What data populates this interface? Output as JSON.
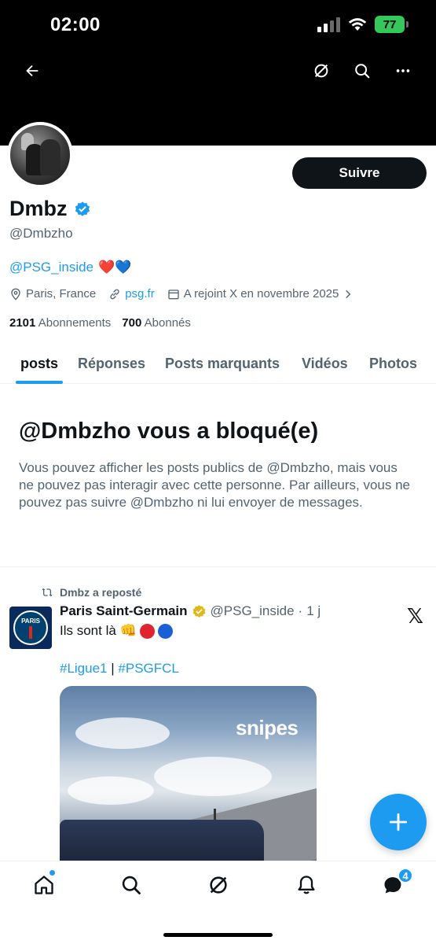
{
  "status_bar": {
    "time": "02:00",
    "battery": "77"
  },
  "header": {
    "back_icon": "arrow-left-icon",
    "grok_icon": "grok-icon",
    "search_icon": "search-icon",
    "more_icon": "more-horizontal-icon"
  },
  "profile": {
    "display_name": "Dmbz",
    "verified": true,
    "handle": "@Dmbzho",
    "bio_link": "@PSG_inside",
    "bio_emojis": "❤️💙",
    "location": "Paris, France",
    "website": "psg.fr",
    "joined": "A rejoint X en novembre 2025",
    "following_count": "2101",
    "following_label": "Abonnements",
    "followers_count": "700",
    "followers_label": "Abonnés",
    "follow_button": "Suivre"
  },
  "tabs": [
    {
      "label": "posts",
      "active": true
    },
    {
      "label": "Réponses",
      "active": false
    },
    {
      "label": "Posts marquants",
      "active": false
    },
    {
      "label": "Vidéos",
      "active": false
    },
    {
      "label": "Photos",
      "active": false
    }
  ],
  "blocked": {
    "title": "@Dmbzho vous a bloqué(e)",
    "message": "Vous pouvez afficher les posts publics de @Dmbzho, mais vous ne pouvez pas interagir avec cette personne. Par ailleurs, vous ne pouvez pas suivre @Dmbzho ni lui envoyer de messages."
  },
  "post": {
    "repost_label": "Dmbz a reposté",
    "author_name": "Paris Saint-Germain",
    "author_handle": "@PSG_inside",
    "separator": "·",
    "time": "1 j",
    "text": "Ils sont là 👊",
    "hashtag_1": "#Ligue1",
    "hashtag_sep": "|",
    "hashtag_2": "#PSGFCL",
    "logo_text": "PARIS",
    "media_watermark": "snipes"
  },
  "bottom_nav": {
    "messages_badge": "4"
  },
  "colors": {
    "accent": "#1d9bf0",
    "gold_verified": "#e2b719",
    "text": "#0f1419",
    "muted": "#536471"
  }
}
